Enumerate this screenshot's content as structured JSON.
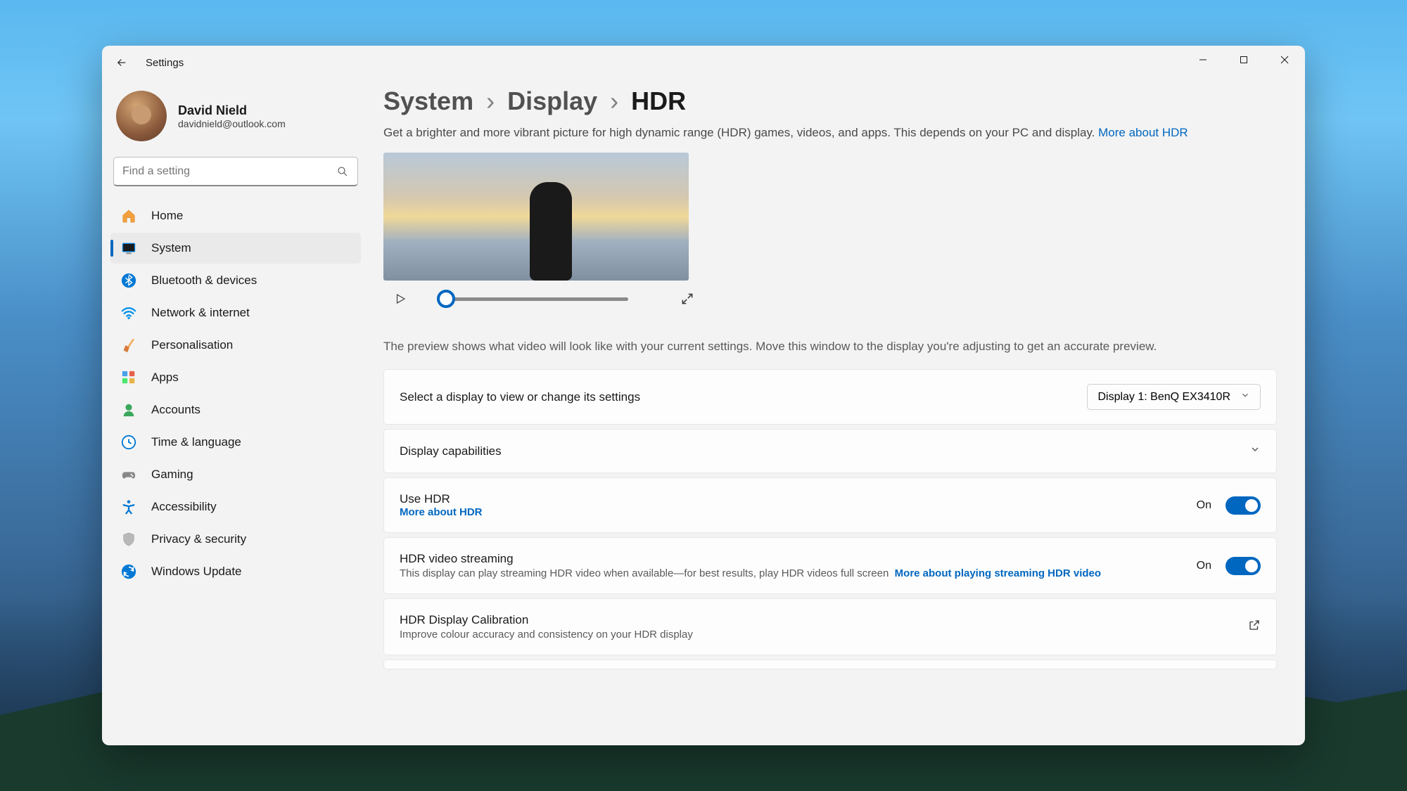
{
  "app": {
    "title": "Settings"
  },
  "user": {
    "name": "David Nield",
    "email": "davidnield@outlook.com"
  },
  "search": {
    "placeholder": "Find a setting"
  },
  "nav": {
    "items": [
      {
        "label": "Home"
      },
      {
        "label": "System"
      },
      {
        "label": "Bluetooth & devices"
      },
      {
        "label": "Network & internet"
      },
      {
        "label": "Personalisation"
      },
      {
        "label": "Apps"
      },
      {
        "label": "Accounts"
      },
      {
        "label": "Time & language"
      },
      {
        "label": "Gaming"
      },
      {
        "label": "Accessibility"
      },
      {
        "label": "Privacy & security"
      },
      {
        "label": "Windows Update"
      }
    ]
  },
  "breadcrumb": {
    "root": "System",
    "mid": "Display",
    "leaf": "HDR"
  },
  "desc": {
    "text": "Get a brighter and more vibrant picture for high dynamic range (HDR) games, videos, and apps. This depends on your PC and display.",
    "link": "More about HDR"
  },
  "preview": {
    "note": "The preview shows what video will look like with your current settings. Move this window to the display you're adjusting to get an accurate preview."
  },
  "display_select": {
    "label": "Select a display to view or change its settings",
    "value": "Display 1: BenQ EX3410R"
  },
  "capabilities": {
    "title": "Display capabilities"
  },
  "use_hdr": {
    "title": "Use HDR",
    "link": "More about HDR",
    "state": "On"
  },
  "hdr_stream": {
    "title": "HDR video streaming",
    "sub": "This display can play streaming HDR video when available—for best results, play HDR videos full screen",
    "link": "More about playing streaming HDR video",
    "state": "On"
  },
  "calibration": {
    "title": "HDR Display Calibration",
    "sub": "Improve colour accuracy and consistency on your HDR display"
  }
}
